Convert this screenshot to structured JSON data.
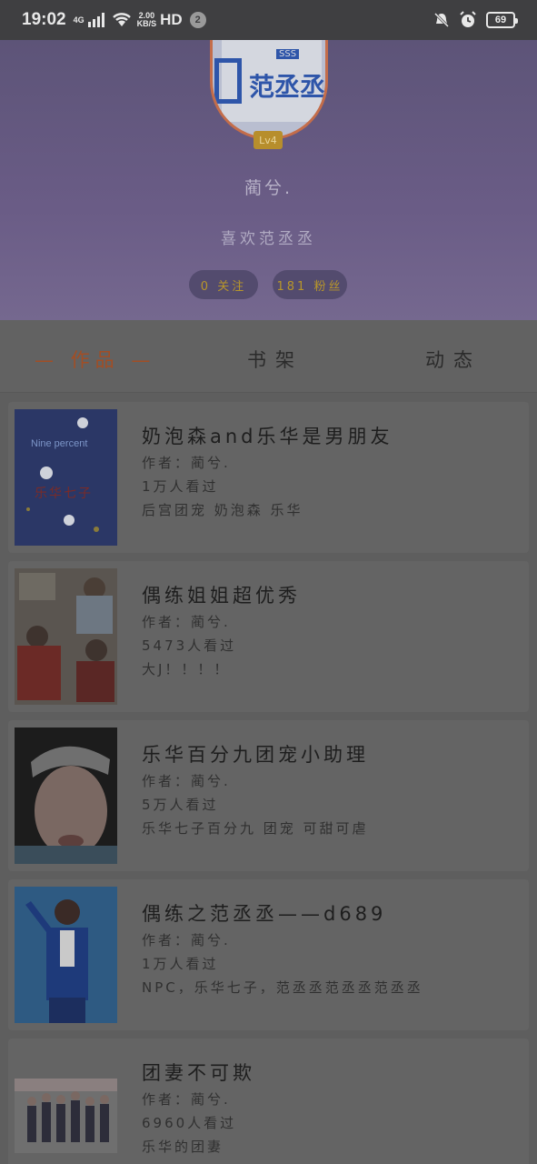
{
  "status_bar": {
    "time": "19:02",
    "network_type": "4G",
    "speed_value": "2.00",
    "speed_unit": "KB/S",
    "hd": "HD",
    "notification_count": "2",
    "battery": "69"
  },
  "profile": {
    "avatar_text": "范丞丞",
    "level": "Lv4",
    "nickname": "蔺兮.",
    "signature": "喜欢范丞丞",
    "following": "0 关注",
    "followers": "181 粉丝"
  },
  "tabs": {
    "works": "— 作品 —",
    "bookshelf": "书架",
    "activity": "动态"
  },
  "works": [
    {
      "title": "奶泡森and乐华是男朋友",
      "author": "作者：蔺兮.",
      "views": "1万人看过",
      "tags": "后宫团宠 奶泡森 乐华",
      "thumb_caption": "Nine percent",
      "thumb_sub": "乐华七子"
    },
    {
      "title": "偶练姐姐超优秀",
      "author": "作者：蔺兮.",
      "views": "5473人看过",
      "tags": "大J！！！！"
    },
    {
      "title": "乐华百分九团宠小助理",
      "author": "作者：蔺兮.",
      "views": "5万人看过",
      "tags": "乐华七子百分九 团宠 可甜可虐"
    },
    {
      "title": "偶练之范丞丞——d689",
      "author": "作者：蔺兮.",
      "views": "1万人看过",
      "tags": "NPC，乐华七子，范丞丞范丞丞范丞丞"
    },
    {
      "title": "团妻不可欺",
      "author": "作者：蔺兮.",
      "views": "6960人看过",
      "tags": "乐华的团妻"
    }
  ],
  "colors": {
    "accent": "#a24e25",
    "header_bg": "#6a5c86",
    "level_badge": "#b78e2c"
  }
}
